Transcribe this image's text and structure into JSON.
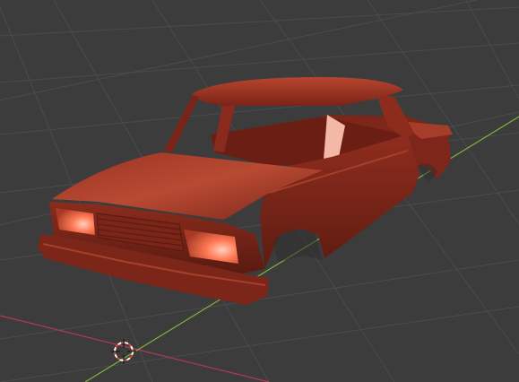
{
  "viewport": {
    "background": "#3c3c3c",
    "grid_color": "#4a4a4a",
    "x_axis_color": "#c0405a",
    "y_axis_color": "#7fb33a",
    "car_body_color": "#8a2a1c",
    "car_highlight_color": "#d6563c",
    "light_color": "#ff6a4a",
    "cursor_ring_colors": [
      "#d44a3a",
      "#ffffff"
    ],
    "object": "car-body",
    "icons": [
      "3d-cursor-icon"
    ]
  }
}
